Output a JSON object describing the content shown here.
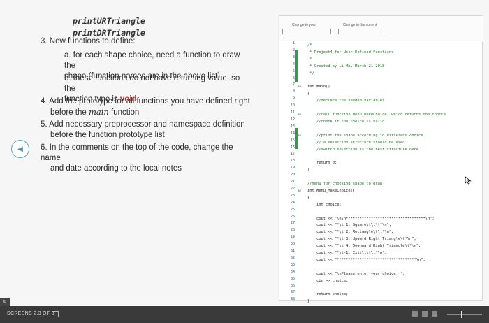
{
  "function_names": [
    "printURTriangle",
    "printDRTriangle"
  ],
  "instructions": {
    "item3": "3. New functions to define:",
    "item3a_line1": "a. for each shape choice, need a function to draw the",
    "item3a_line2": "shape (function names are in the above list)",
    "item3b_line1": "b. these functions do not have returning value, so the",
    "item3b_line2_pre": "function type is ",
    "item3b_void": "void",
    "item4_line1": "4. Add the prototype for all functions you have defined right",
    "item4_line2_pre": "before the ",
    "item4_main": "main",
    "item4_line2_post": " function",
    "item5_line1": "5. Add necessary preprocessor and namespace definition",
    "item5_line2": "before the function prototype list",
    "item6_line1": "6. In the comments on the top of the code, change the name",
    "item6_line2": "and date according to the local notes"
  },
  "code_image": {
    "top_caption_1": "Change to your",
    "top_caption_2": "Change to the current",
    "line_numbers": [
      "1",
      "2",
      "3",
      "4",
      "5",
      "6",
      "7",
      "8",
      "9",
      "10",
      "11",
      "12",
      "13",
      "14",
      "15",
      "16",
      "17",
      "18",
      "19",
      "20",
      "21",
      "22",
      "23",
      "24",
      "25",
      "26",
      "27",
      "28",
      "29",
      "30",
      "31",
      "32",
      "33",
      "34",
      "35",
      "36",
      "37",
      "38"
    ],
    "lines": [
      "/*",
      " * Project4 for User-Defined Functions",
      " *",
      " * Created by Li Ma, March 21 2018",
      " */",
      "",
      "int main()",
      "{",
      "    //declare the needed variables",
      "",
      "    //call function Menu_MakeChoice, which returns the choice",
      "    //check if the choice is valid",
      "",
      "    //print the shape according to different choice",
      "    // a selection structure should be used",
      "    //switch selection is the best structure here",
      "",
      "    return 0;",
      "}",
      "",
      "//menu for choosing shape to draw",
      "int Menu_MakeChoice()",
      "{",
      "    int choice;",
      "",
      "    cout << \"\\n\\n***********************************\\n\";",
      "    cout << \"*\\t 1. Square\\t\\t\\t*\\n\";",
      "    cout << \"*\\t 2. Rectangle\\t\\t*\\n\";",
      "    cout << \"*\\t 3. Upward Right Triangle\\t*\\n\";",
      "    cout << \"*\\t 4. Downward Right Triangle\\t*\\n\";",
      "    cout << \"*\\t-1. Exit\\t\\t\\t*\\n\";",
      "    cout << \"***********************************\\n\";",
      "",
      "    cout << \"\\nPlease enter your choice: \";",
      "    cin >> choice;",
      "",
      "    return choice;",
      "}"
    ]
  },
  "taskbar": {
    "label": "SCREENS 2.3 OF 3",
    "fb": "fb"
  }
}
